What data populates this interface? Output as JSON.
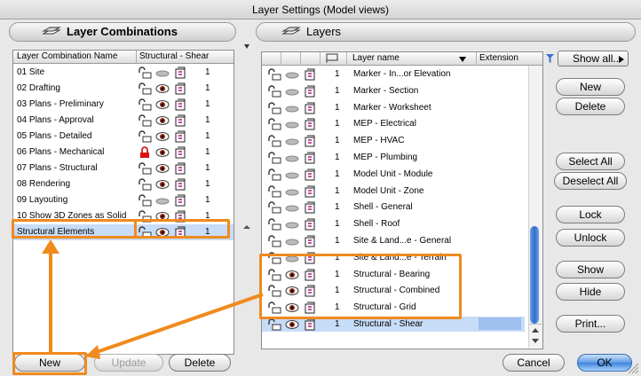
{
  "window": {
    "title": "Layer Settings (Model views)"
  },
  "left_pane": {
    "title": "Layer Combinations",
    "columns": [
      "Layer Combination Name",
      "Structural - Shear"
    ],
    "rows": [
      {
        "name": "01 Site",
        "lock": "unlocked",
        "visible": false,
        "num": "1"
      },
      {
        "name": "02 Drafting",
        "lock": "unlocked",
        "visible": true,
        "num": "1"
      },
      {
        "name": "03 Plans - Preliminary",
        "lock": "unlocked",
        "visible": true,
        "num": "1"
      },
      {
        "name": "04 Plans - Approval",
        "lock": "unlocked",
        "visible": true,
        "num": "1"
      },
      {
        "name": "05 Plans - Detailed",
        "lock": "unlocked",
        "visible": true,
        "num": "1"
      },
      {
        "name": "06 Plans - Mechanical",
        "lock": "locked",
        "visible": true,
        "num": "1"
      },
      {
        "name": "07 Plans - Structural",
        "lock": "unlocked",
        "visible": true,
        "num": "1"
      },
      {
        "name": "08 Rendering",
        "lock": "unlocked",
        "visible": true,
        "num": "1"
      },
      {
        "name": "09 Layouting",
        "lock": "unlocked",
        "visible": false,
        "num": "1"
      },
      {
        "name": "10 Show 3D Zones as Solid",
        "lock": "unlocked",
        "visible": true,
        "num": "1"
      },
      {
        "name": "Structural Elements",
        "lock": "unlocked",
        "visible": true,
        "num": "1"
      }
    ],
    "buttons": {
      "new": "New",
      "update": "Update",
      "delete": "Delete"
    }
  },
  "right_pane": {
    "title": "Layers",
    "columns": {
      "name": "Layer name",
      "extension": "Extension"
    },
    "rows": [
      {
        "name": "Marker - In...or Elevation",
        "visible": false,
        "num": "1"
      },
      {
        "name": "Marker - Section",
        "visible": false,
        "num": "1"
      },
      {
        "name": "Marker - Worksheet",
        "visible": false,
        "num": "1"
      },
      {
        "name": "MEP - Electrical",
        "visible": false,
        "num": "1"
      },
      {
        "name": "MEP - HVAC",
        "visible": false,
        "num": "1"
      },
      {
        "name": "MEP - Plumbing",
        "visible": false,
        "num": "1"
      },
      {
        "name": "Model Unit - Module",
        "visible": false,
        "num": "1"
      },
      {
        "name": "Model Unit - Zone",
        "visible": false,
        "num": "1"
      },
      {
        "name": "Shell - General",
        "visible": false,
        "num": "1"
      },
      {
        "name": "Shell - Roof",
        "visible": false,
        "num": "1"
      },
      {
        "name": "Site & Land...e - General",
        "visible": false,
        "num": "1"
      },
      {
        "name": "Site & Land...e - Terrain",
        "visible": false,
        "num": "1"
      },
      {
        "name": "Structural - Bearing",
        "visible": true,
        "num": "1"
      },
      {
        "name": "Structural - Combined",
        "visible": true,
        "num": "1"
      },
      {
        "name": "Structural - Grid",
        "visible": true,
        "num": "1"
      },
      {
        "name": "Structural - Shear",
        "visible": true,
        "num": "1"
      }
    ]
  },
  "side_buttons": {
    "show_all": "Show all...",
    "new": "New",
    "delete": "Delete",
    "select_all": "Select All",
    "deselect_all": "Deselect All",
    "lock": "Lock",
    "unlock": "Unlock",
    "show": "Show",
    "hide": "Hide",
    "print": "Print..."
  },
  "footer": {
    "cancel": "Cancel",
    "ok": "OK"
  },
  "colors": {
    "highlight": "#f08a1d",
    "selection": "#c7dcf7",
    "accent": "#3c82de"
  }
}
